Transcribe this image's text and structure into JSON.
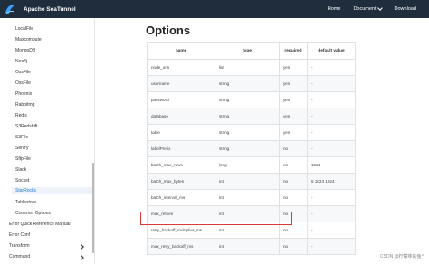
{
  "header": {
    "brand": "Apache SeaTunnel",
    "nav": [
      {
        "label": "Home"
      },
      {
        "label": "Document",
        "has_dropdown": true
      },
      {
        "label": "Download"
      }
    ]
  },
  "sidebar": {
    "items": [
      {
        "label": "LocalFile",
        "active": false
      },
      {
        "label": "Maxcompute",
        "active": false
      },
      {
        "label": "MongoDB",
        "active": false
      },
      {
        "label": "Neo4j",
        "active": false
      },
      {
        "label": "OssFile",
        "active": false
      },
      {
        "label": "OssFile",
        "active": false
      },
      {
        "label": "Phoenix",
        "active": false
      },
      {
        "label": "Rabbitmq",
        "active": false
      },
      {
        "label": "Redis",
        "active": false
      },
      {
        "label": "S3Redshift",
        "active": false
      },
      {
        "label": "S3File",
        "active": false
      },
      {
        "label": "Sentry",
        "active": false
      },
      {
        "label": "SftpFile",
        "active": false
      },
      {
        "label": "Slack",
        "active": false
      },
      {
        "label": "Socket",
        "active": false
      },
      {
        "label": "StarRocks",
        "active": true
      },
      {
        "label": "Tablestore",
        "active": false
      },
      {
        "label": "Common Options",
        "active": false
      }
    ],
    "top_items": [
      {
        "label": "Error Quick Reference Manual"
      },
      {
        "label": "Error Conf"
      },
      {
        "label": "Transform",
        "expandable": true
      },
      {
        "label": "Command",
        "expandable": true
      }
    ]
  },
  "main": {
    "title": "Options",
    "table": {
      "headers": [
        "name",
        "type",
        "required",
        "default value"
      ],
      "rows": [
        [
          "node_urls",
          "list",
          "yes",
          "-"
        ],
        [
          "username",
          "string",
          "yes",
          "-"
        ],
        [
          "password",
          "string",
          "yes",
          "-"
        ],
        [
          "database",
          "string",
          "yes",
          "-"
        ],
        [
          "table",
          "string",
          "yes",
          "-"
        ],
        [
          "labelPrefix",
          "string",
          "no",
          "-"
        ],
        [
          "batch_max_rows",
          "long",
          "no",
          "1024"
        ],
        [
          "batch_max_bytes",
          "int",
          "no",
          "5 1024 1024"
        ],
        [
          "batch_interval_ms",
          "int",
          "no",
          "-"
        ],
        [
          "max_retries",
          "int",
          "no",
          "-"
        ],
        [
          "retry_backoff_multiplier_ms",
          "int",
          "no",
          "-"
        ],
        [
          "max_retry_backoff_ms",
          "int",
          "no",
          "-"
        ]
      ]
    }
  },
  "watermark": "CSDN @柠檬味的鱼^"
}
